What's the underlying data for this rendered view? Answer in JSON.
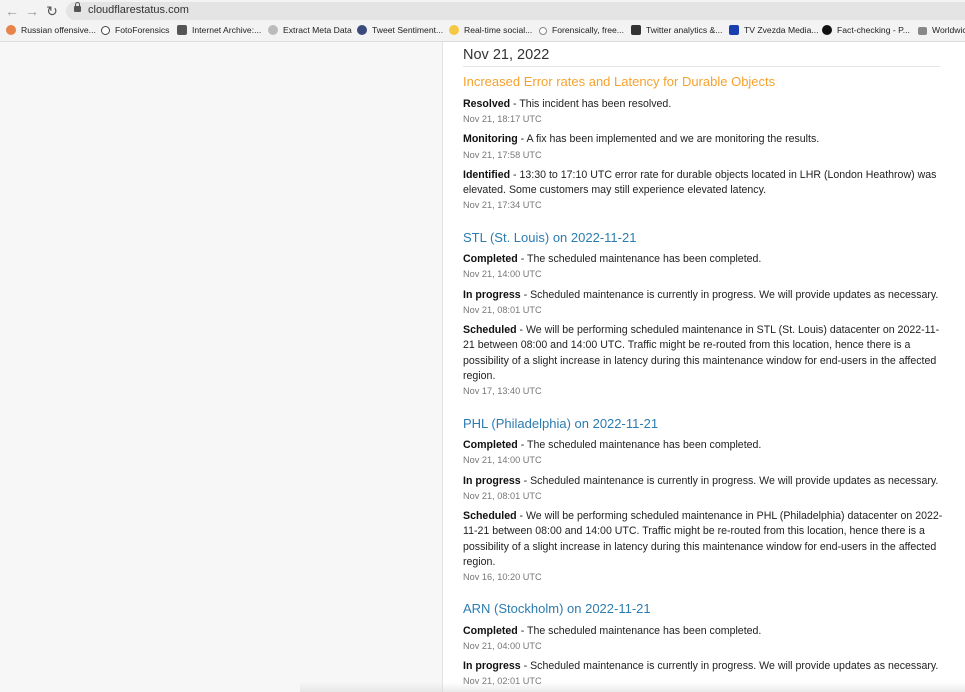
{
  "browser": {
    "url": "cloudflarestatus.com",
    "back_icon": "←",
    "forward_icon": "→",
    "reload_icon": "↻"
  },
  "bookmarks": [
    {
      "label": "Russian offensive...",
      "icon": "dot-icon",
      "color": "#e8834a"
    },
    {
      "label": "FotoForensics",
      "icon": "gear-icon",
      "color": "#444444"
    },
    {
      "label": "Internet Archive:...",
      "icon": "archive-icon",
      "color": "#555555"
    },
    {
      "label": "Extract Meta Data",
      "icon": "globe-icon",
      "color": "#999999"
    },
    {
      "label": "Tweet Sentiment...",
      "icon": "globe-icon",
      "color": "#3a4a7a"
    },
    {
      "label": "Real-time social...",
      "icon": "bulb-icon",
      "color": "#f5c842"
    },
    {
      "label": "Forensically, free...",
      "icon": "magnifier-icon",
      "color": "#888888"
    },
    {
      "label": "Twitter analytics &...",
      "icon": "chart-icon",
      "color": "#333333"
    },
    {
      "label": "TV Zvezda Media...",
      "icon": "m-icon",
      "color": "#1a3fb0"
    },
    {
      "label": "Fact-checking - P...",
      "icon": "circle-icon",
      "color": "#111111"
    },
    {
      "label": "Worldwic",
      "icon": "flag-icon",
      "color": "#666666"
    }
  ],
  "main": {
    "date": "Nov 21, 2022",
    "incidents": [
      {
        "title": "Increased Error rates and Latency for Durable Objects",
        "color": "#f6a22f",
        "updates": [
          {
            "status": "Resolved",
            "text": " - This incident has been resolved.",
            "time": "Nov 21, 18:17 UTC"
          },
          {
            "status": "Monitoring",
            "text": " - A fix has been implemented and we are monitoring the results.",
            "time": "Nov 21, 17:58 UTC"
          },
          {
            "status": "Identified",
            "text": " - 13:30 to 17:10 UTC error rate for durable objects located in LHR (London Heathrow) was elevated. Some customers may still experience elevated latency.",
            "time": "Nov 21, 17:34 UTC"
          }
        ]
      },
      {
        "title": "STL (St. Louis) on 2022-11-21",
        "color": "#2c7cb0",
        "updates": [
          {
            "status": "Completed",
            "text": " - The scheduled maintenance has been completed.",
            "time": "Nov 21, 14:00 UTC"
          },
          {
            "status": "In progress",
            "text": " - Scheduled maintenance is currently in progress. We will provide updates as necessary.",
            "time": "Nov 21, 08:01 UTC"
          },
          {
            "status": "Scheduled",
            "text": " - We will be performing scheduled maintenance in STL (St. Louis) datacenter on 2022-11-21 between 08:00 and 14:00 UTC. Traffic might be re-routed from this location, hence there is a possibility of a slight increase in latency during this maintenance window for end-users in the affected region.",
            "time": "Nov 17, 13:40 UTC"
          }
        ]
      },
      {
        "title": "PHL (Philadelphia) on 2022-11-21",
        "color": "#2c7cb0",
        "updates": [
          {
            "status": "Completed",
            "text": " - The scheduled maintenance has been completed.",
            "time": "Nov 21, 14:00 UTC"
          },
          {
            "status": "In progress",
            "text": " - Scheduled maintenance is currently in progress. We will provide updates as necessary.",
            "time": "Nov 21, 08:01 UTC"
          },
          {
            "status": "Scheduled",
            "text": " - We will be performing scheduled maintenance in PHL (Philadelphia) datacenter on 2022-11-21 between 08:00 and 14:00 UTC. Traffic might be re-routed from this location, hence there is a possibility of a slight increase in latency during this maintenance window for end-users in the affected region.",
            "time": "Nov 16, 10:20 UTC"
          }
        ]
      },
      {
        "title": "ARN (Stockholm) on 2022-11-21",
        "color": "#2c7cb0",
        "updates": [
          {
            "status": "Completed",
            "text": " - The scheduled maintenance has been completed.",
            "time": "Nov 21, 04:00 UTC"
          },
          {
            "status": "In progress",
            "text": " - Scheduled maintenance is currently in progress. We will provide updates as necessary.",
            "time": "Nov 21, 02:01 UTC"
          }
        ]
      }
    ]
  }
}
